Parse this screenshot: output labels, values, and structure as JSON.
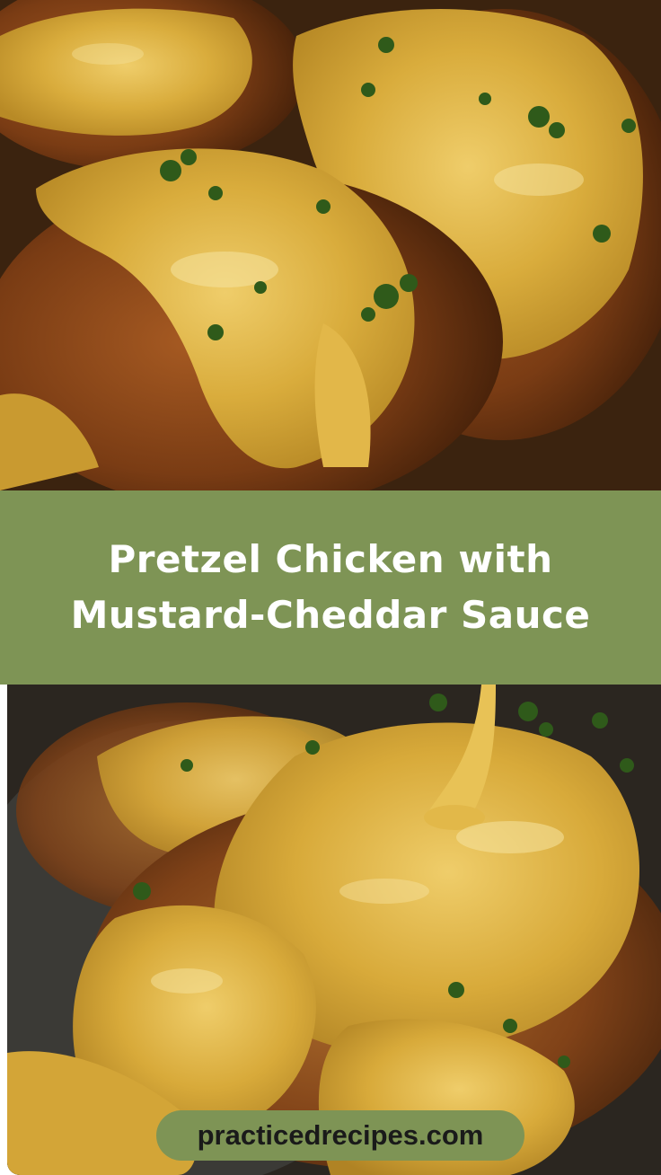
{
  "title": {
    "line1": "Pretzel Chicken with",
    "line2": "Mustard-Cheddar Sauce"
  },
  "website": {
    "label": "practicedrecipes.com"
  },
  "colors": {
    "band": "#7e9455",
    "title_text": "#ffffff",
    "site_text": "#1a1a1a",
    "sauce": "#d9ac3c",
    "crust": "#8a4a1c",
    "parsley": "#2f5a1a"
  },
  "images": {
    "top": "pretzel-chicken-topped-with-mustard-cheddar-sauce-and-parsley-photo",
    "bottom": "mustard-cheddar-sauce-pouring-over-pretzel-chicken-photo"
  }
}
